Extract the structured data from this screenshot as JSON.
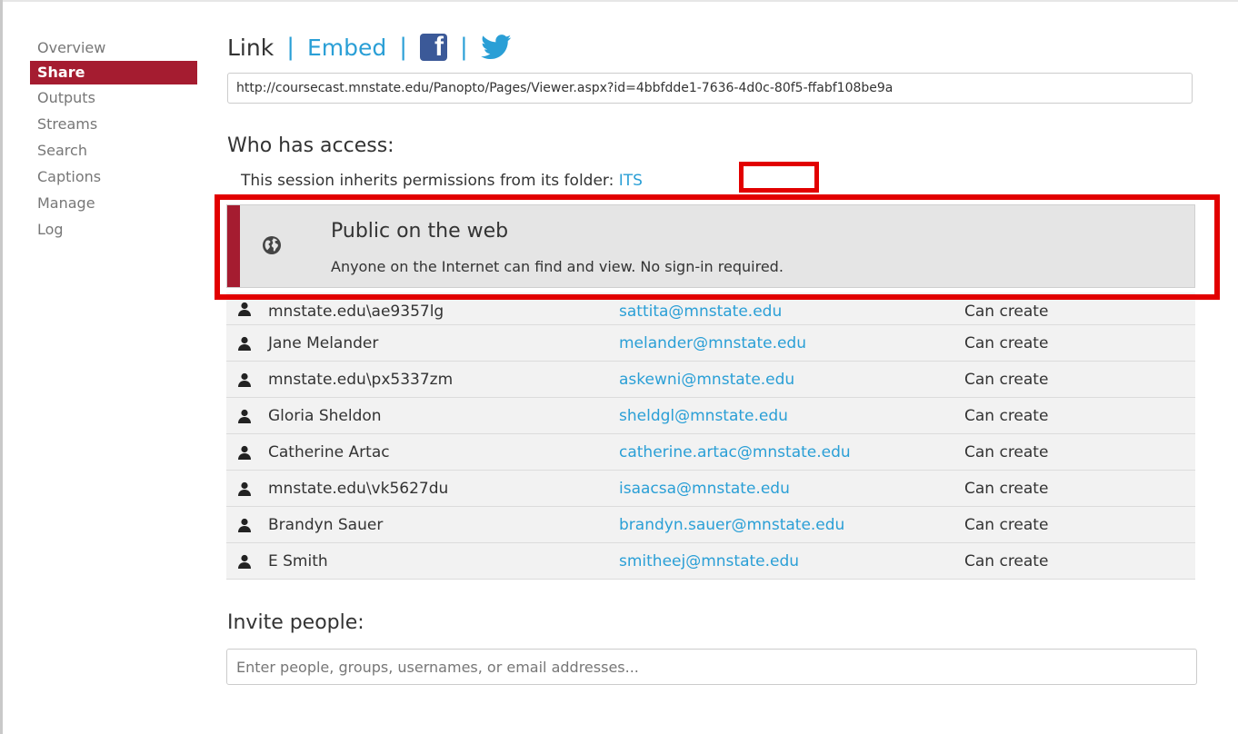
{
  "sidebar": {
    "items": [
      {
        "label": "Overview",
        "active": false
      },
      {
        "label": "Share",
        "active": true
      },
      {
        "label": "Outputs",
        "active": false
      },
      {
        "label": "Streams",
        "active": false
      },
      {
        "label": "Search",
        "active": false
      },
      {
        "label": "Captions",
        "active": false
      },
      {
        "label": "Manage",
        "active": false
      },
      {
        "label": "Log",
        "active": false
      }
    ]
  },
  "share": {
    "tabs": {
      "link": "Link",
      "embed": "Embed",
      "separator": "|"
    },
    "icons": {
      "facebook": "facebook-icon",
      "twitter": "twitter-icon"
    },
    "url": "http://coursecast.mnstate.edu/Panopto/Pages/Viewer.aspx?id=4bbfdde1-7636-4d0c-80f5-ffabf108be9a"
  },
  "access": {
    "heading": "Who has access:",
    "inherit_text": "This session inherits permissions from its folder: ",
    "folder_name": "ITS",
    "public": {
      "title": "Public on the web",
      "description": "Anyone on the Internet can find and view. No sign-in required.",
      "icon": "globe-icon"
    },
    "people": [
      {
        "name": "mnstate.edu\\ae9357lg",
        "email": "sattita@mnstate.edu",
        "role": "Can create"
      },
      {
        "name": "Jane Melander",
        "email": "melander@mnstate.edu",
        "role": "Can create"
      },
      {
        "name": "mnstate.edu\\px5337zm",
        "email": "askewni@mnstate.edu",
        "role": "Can create"
      },
      {
        "name": "Gloria Sheldon",
        "email": "sheldgl@mnstate.edu",
        "role": "Can create"
      },
      {
        "name": "Catherine Artac",
        "email": "catherine.artac@mnstate.edu",
        "role": "Can create"
      },
      {
        "name": "mnstate.edu\\vk5627du",
        "email": "isaacsa@mnstate.edu",
        "role": "Can create"
      },
      {
        "name": "Brandyn Sauer",
        "email": "brandyn.sauer@mnstate.edu",
        "role": "Can create"
      },
      {
        "name": "E Smith",
        "email": "smitheej@mnstate.edu",
        "role": "Can create"
      }
    ]
  },
  "invite": {
    "heading": "Invite people:",
    "placeholder": "Enter people, groups, usernames, or email addresses..."
  },
  "colors": {
    "accent": "#a51c30",
    "link": "#2a9fd6",
    "annotation": "#e20000"
  }
}
